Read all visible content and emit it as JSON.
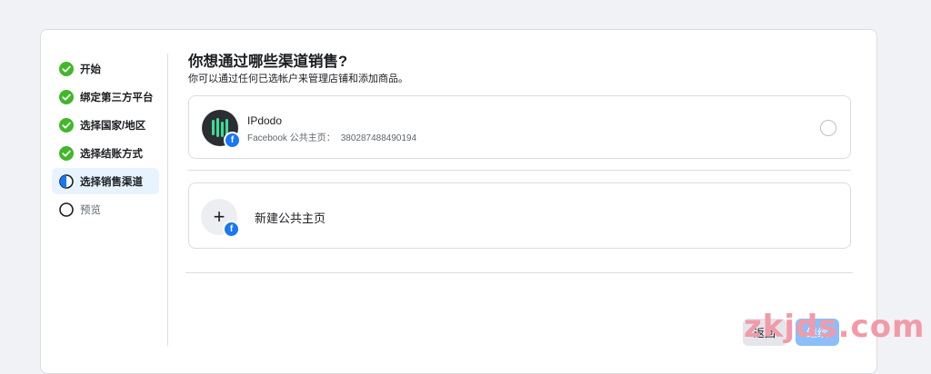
{
  "steps": [
    {
      "label": "开始",
      "state": "done"
    },
    {
      "label": "绑定第三方平台",
      "state": "done"
    },
    {
      "label": "选择国家/地区",
      "state": "done"
    },
    {
      "label": "选择结账方式",
      "state": "done"
    },
    {
      "label": "选择销售渠道",
      "state": "active"
    },
    {
      "label": "预览",
      "state": "future"
    }
  ],
  "main": {
    "title": "你想通过哪些渠道销售?",
    "subtitle": "你可以通过任何已选帐户来管理店铺和添加商品。"
  },
  "page_option": {
    "name": "IPdodo",
    "meta_label": "Facebook 公共主页：",
    "page_id": "380287488490194",
    "selected": false
  },
  "new_page_option": {
    "label": "新建公共主页",
    "plus_glyph": "+"
  },
  "buttons": {
    "back": "返回",
    "continue": "继续"
  },
  "watermark": "zkjds.com",
  "colors": {
    "done": "#42b72a",
    "active": "#1877f2",
    "facebook": "#1877f2",
    "continue_disabled": "#8cbef9"
  }
}
